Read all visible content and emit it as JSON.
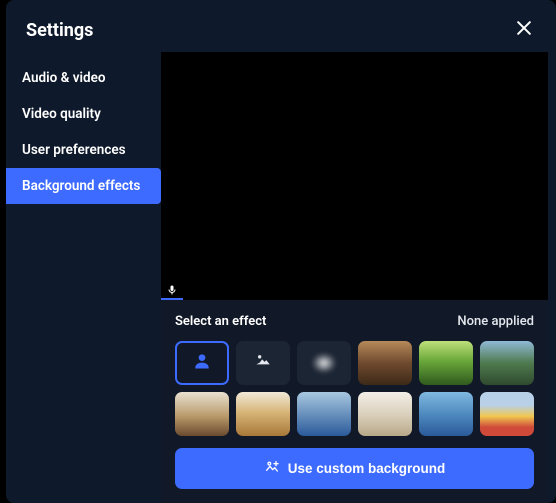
{
  "header": {
    "title": "Settings"
  },
  "sidebar": {
    "items": [
      {
        "label": "Audio & video",
        "active": false
      },
      {
        "label": "Video quality",
        "active": false
      },
      {
        "label": "User preferences",
        "active": false
      },
      {
        "label": "Background effects",
        "active": true
      }
    ]
  },
  "effects": {
    "title": "Select an effect",
    "status": "None applied",
    "custom_button_label": "Use custom background"
  },
  "icons": {
    "close": "close-icon",
    "mic": "microphone-icon",
    "person": "person-icon",
    "image": "image-icon",
    "blur": "blur-icon",
    "image_add": "image-add-icon"
  },
  "colors": {
    "accent": "#3e6bff",
    "panel_bg": "#111827",
    "modal_bg": "#0e1a2b"
  }
}
